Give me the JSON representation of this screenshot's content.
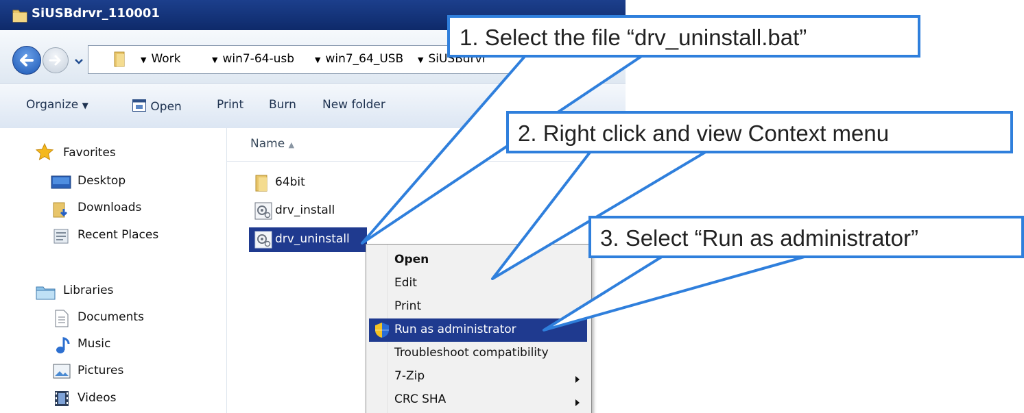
{
  "window": {
    "title": "SiUSBdrvr_110001"
  },
  "address_bar": {
    "breadcrumbs": [
      "Work",
      "win7-64-usb",
      "win7_64_USB",
      "SiUSBdrvr"
    ]
  },
  "toolbar": {
    "organize_label": "Organize",
    "open_label": "Open",
    "print_label": "Print",
    "burn_label": "Burn",
    "new_folder_label": "New folder"
  },
  "nav": {
    "favorites": {
      "label": "Favorites",
      "icon": "star-icon"
    },
    "favorites_items": [
      {
        "label": "Desktop",
        "icon": "desktop-icon"
      },
      {
        "label": "Downloads",
        "icon": "downloads-folder-icon"
      },
      {
        "label": "Recent Places",
        "icon": "recent-places-icon"
      }
    ],
    "libraries": {
      "label": "Libraries",
      "icon": "libraries-icon"
    },
    "libraries_items": [
      {
        "label": "Documents",
        "icon": "document-icon"
      },
      {
        "label": "Music",
        "icon": "music-note-icon"
      },
      {
        "label": "Pictures",
        "icon": "picture-icon"
      },
      {
        "label": "Videos",
        "icon": "film-icon"
      }
    ]
  },
  "file_list": {
    "column_name": "Name",
    "sort": "ascending",
    "files": [
      {
        "name": "64bit",
        "icon": "folder-icon",
        "selected": false
      },
      {
        "name": "drv_install",
        "icon": "batch-file-icon",
        "selected": false
      },
      {
        "name": "drv_uninstall",
        "icon": "batch-file-icon",
        "selected": true
      }
    ]
  },
  "context_menu": {
    "items": [
      {
        "label": "Open",
        "bold": true
      },
      {
        "label": "Edit"
      },
      {
        "label": "Print"
      },
      {
        "label": "Run as administrator",
        "icon": "uac-shield-icon",
        "highlighted": true
      },
      {
        "label": "Troubleshoot compatibility"
      },
      {
        "label": "7-Zip",
        "submenu": true
      },
      {
        "label": "CRC SHA",
        "submenu": true
      }
    ]
  },
  "callouts": [
    {
      "text": "1.  Select the file “drv_uninstall.bat”"
    },
    {
      "text": "2.  Right click and view Context menu"
    },
    {
      "text": "3.  Select “Run as administrator”"
    }
  ],
  "colors": {
    "selection": "#1f3a8f",
    "callout_border": "#2f7fdc",
    "titlebar": "#1c3f8c"
  }
}
